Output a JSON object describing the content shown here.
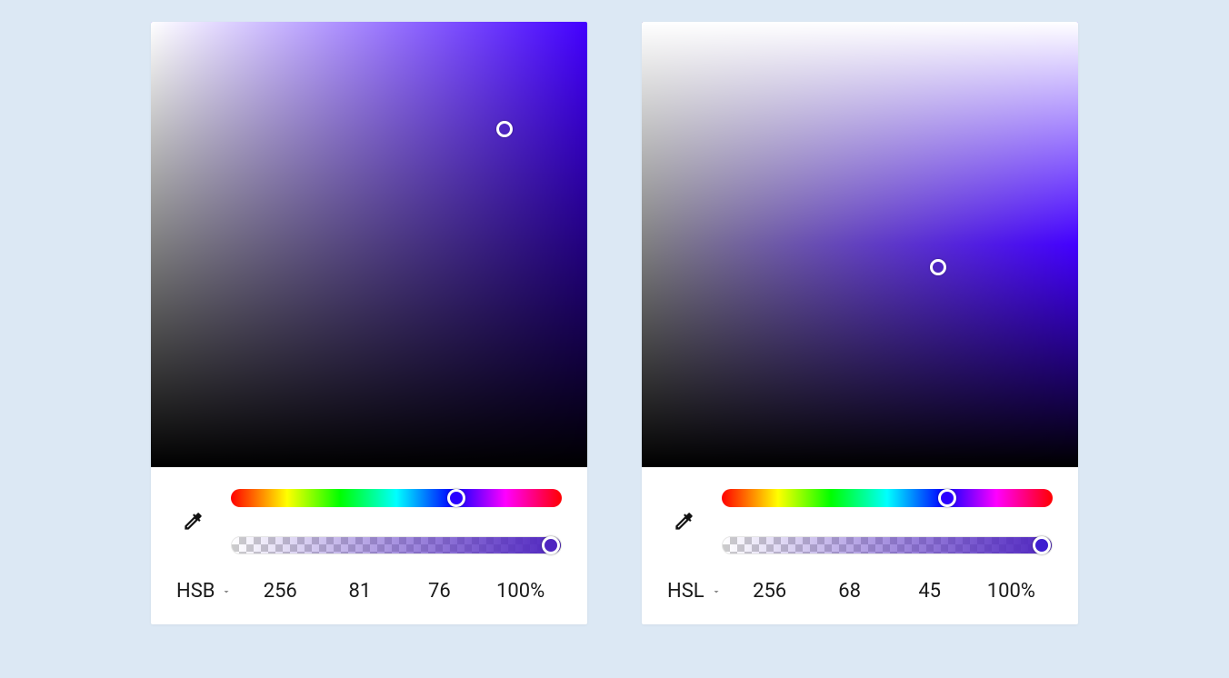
{
  "panels": [
    {
      "mode_label": "HSB",
      "hue_color": "#4300ff",
      "sb_thumb": {
        "left_pct": 81,
        "top_pct": 24
      },
      "hue_thumb_left_pct": 68,
      "alpha_gradient_to": "#4f25c0",
      "alpha_thumb_color": "#4f25c0",
      "alpha_thumb_left_pct": 97,
      "values": {
        "h": "256",
        "s": "81",
        "b": "76",
        "a": "100%"
      }
    },
    {
      "mode_label": "HSL",
      "hue_color": "#4300ff",
      "sb_thumb": {
        "left_pct": 68,
        "top_pct": 55
      },
      "hue_thumb_left_pct": 68,
      "alpha_gradient_to": "#4f25c0",
      "alpha_thumb_color": "#3e1dd0",
      "alpha_thumb_left_pct": 97,
      "values": {
        "h": "256",
        "s": "68",
        "l": "45",
        "a": "100%"
      }
    }
  ]
}
